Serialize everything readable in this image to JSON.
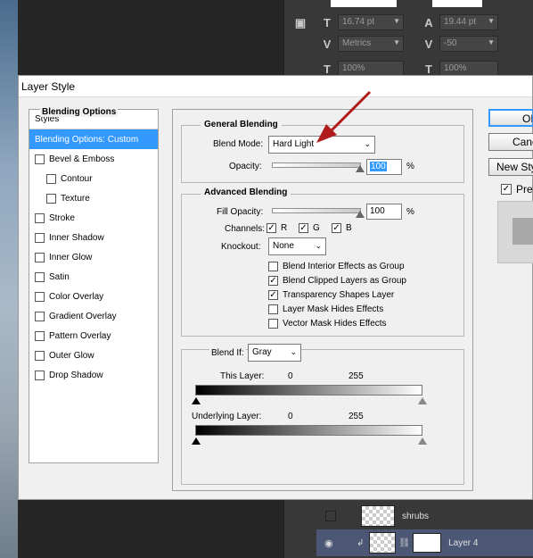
{
  "dialog": {
    "title": "Layer Style",
    "styles_header": "Styles",
    "styles": [
      {
        "label": "Blending Options: Custom",
        "selected": true,
        "checkbox": false,
        "checked": false,
        "indent": false
      },
      {
        "label": "Bevel & Emboss",
        "checkbox": true,
        "checked": false,
        "indent": false
      },
      {
        "label": "Contour",
        "checkbox": true,
        "checked": false,
        "indent": true
      },
      {
        "label": "Texture",
        "checkbox": true,
        "checked": false,
        "indent": true
      },
      {
        "label": "Stroke",
        "checkbox": true,
        "checked": false,
        "indent": false
      },
      {
        "label": "Inner Shadow",
        "checkbox": true,
        "checked": false,
        "indent": false
      },
      {
        "label": "Inner Glow",
        "checkbox": true,
        "checked": false,
        "indent": false
      },
      {
        "label": "Satin",
        "checkbox": true,
        "checked": false,
        "indent": false
      },
      {
        "label": "Color Overlay",
        "checkbox": true,
        "checked": false,
        "indent": false
      },
      {
        "label": "Gradient Overlay",
        "checkbox": true,
        "checked": false,
        "indent": false
      },
      {
        "label": "Pattern Overlay",
        "checkbox": true,
        "checked": false,
        "indent": false
      },
      {
        "label": "Outer Glow",
        "checkbox": true,
        "checked": false,
        "indent": false
      },
      {
        "label": "Drop Shadow",
        "checkbox": true,
        "checked": false,
        "indent": false
      }
    ],
    "blending_options_title": "Blending Options",
    "general": {
      "title": "General Blending",
      "blend_mode_label": "Blend Mode:",
      "blend_mode_value": "Hard Light",
      "opacity_label": "Opacity:",
      "opacity_value": "100",
      "opacity_unit": "%"
    },
    "advanced": {
      "title": "Advanced Blending",
      "fill_opacity_label": "Fill Opacity:",
      "fill_opacity_value": "100",
      "fill_opacity_unit": "%",
      "channels_label": "Channels:",
      "channels": [
        {
          "label": "R",
          "checked": true
        },
        {
          "label": "G",
          "checked": true
        },
        {
          "label": "B",
          "checked": true
        }
      ],
      "knockout_label": "Knockout:",
      "knockout_value": "None",
      "options": [
        {
          "label": "Blend Interior Effects as Group",
          "checked": false
        },
        {
          "label": "Blend Clipped Layers as Group",
          "checked": true
        },
        {
          "label": "Transparency Shapes Layer",
          "checked": true
        },
        {
          "label": "Layer Mask Hides Effects",
          "checked": false
        },
        {
          "label": "Vector Mask Hides Effects",
          "checked": false
        }
      ]
    },
    "blend_if": {
      "label": "Blend If:",
      "value": "Gray",
      "this_layer_label": "This Layer:",
      "this_layer_min": "0",
      "this_layer_max": "255",
      "underlying_label": "Underlying Layer:",
      "underlying_min": "0",
      "underlying_max": "255"
    },
    "buttons": {
      "ok": "OK",
      "cancel": "Cancel",
      "new_style": "New Style...",
      "preview": "Preview"
    }
  },
  "ps_panel": {
    "font_size": "16.74 pt",
    "leading": "19.44 pt",
    "kerning": "Metrics",
    "tracking": "-50",
    "vscale": "100%",
    "hscale": "100%"
  },
  "layers": [
    {
      "name": "shrubs",
      "visible": false,
      "selected": false
    },
    {
      "name": "Layer 4",
      "visible": true,
      "selected": true
    }
  ],
  "colors": {
    "selection_blue": "#3399ff",
    "annotation_arrow": "#b01c1c"
  }
}
